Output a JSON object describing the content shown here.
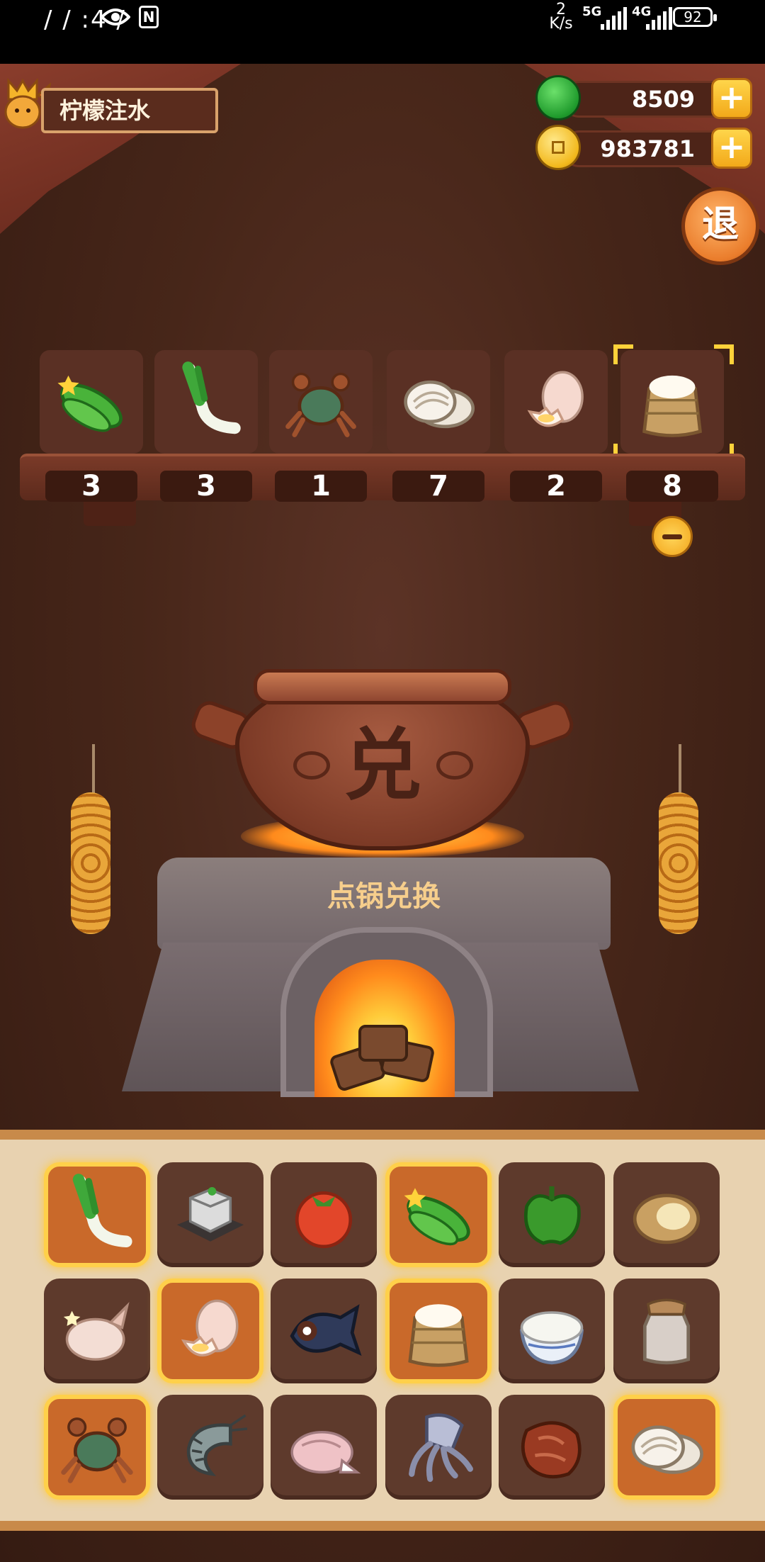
{
  "status_bar": {
    "time": "/ / :4 /",
    "net_speed_value": "2",
    "net_speed_unit": "K/s",
    "sim1": "5G",
    "sim2": "4G",
    "battery": "92"
  },
  "player": {
    "name": "柠檬注水"
  },
  "currency": {
    "gems": "8509",
    "coins": "983781"
  },
  "exit_button": {
    "label": "退"
  },
  "selected": [
    {
      "item": "cucumber-icon",
      "count": "3"
    },
    {
      "item": "scallion-icon",
      "count": "3"
    },
    {
      "item": "crab-icon",
      "count": "1"
    },
    {
      "item": "clam-icon",
      "count": "7"
    },
    {
      "item": "egg-icon",
      "count": "2"
    },
    {
      "item": "flour-sack-icon",
      "count": "8",
      "focused": true
    }
  ],
  "pot": {
    "character": "兑",
    "action_label": "点锅兑换"
  },
  "inventory": [
    [
      {
        "item": "scallion-icon",
        "selected": true
      },
      {
        "item": "tofu-icon",
        "selected": false
      },
      {
        "item": "tomato-icon",
        "selected": false
      },
      {
        "item": "cucumber-icon",
        "selected": true
      },
      {
        "item": "green-pepper-icon",
        "selected": false
      },
      {
        "item": "potato-icon",
        "selected": false
      }
    ],
    [
      {
        "item": "chicken-icon",
        "selected": false
      },
      {
        "item": "egg-icon",
        "selected": true
      },
      {
        "item": "fish-icon",
        "selected": false
      },
      {
        "item": "flour-sack-icon",
        "selected": true
      },
      {
        "item": "rice-bowl-icon",
        "selected": false
      },
      {
        "item": "jar-icon",
        "selected": false
      }
    ],
    [
      {
        "item": "crab-icon",
        "selected": true
      },
      {
        "item": "shrimp-icon",
        "selected": false
      },
      {
        "item": "duck-icon",
        "selected": false
      },
      {
        "item": "squid-icon",
        "selected": false
      },
      {
        "item": "ham-icon",
        "selected": false
      },
      {
        "item": "clam-icon",
        "selected": true
      }
    ]
  ],
  "colors": {
    "accent_gold": "#ffd04a",
    "selected_orange": "#c9692a",
    "fire": "#ff8a1c"
  }
}
